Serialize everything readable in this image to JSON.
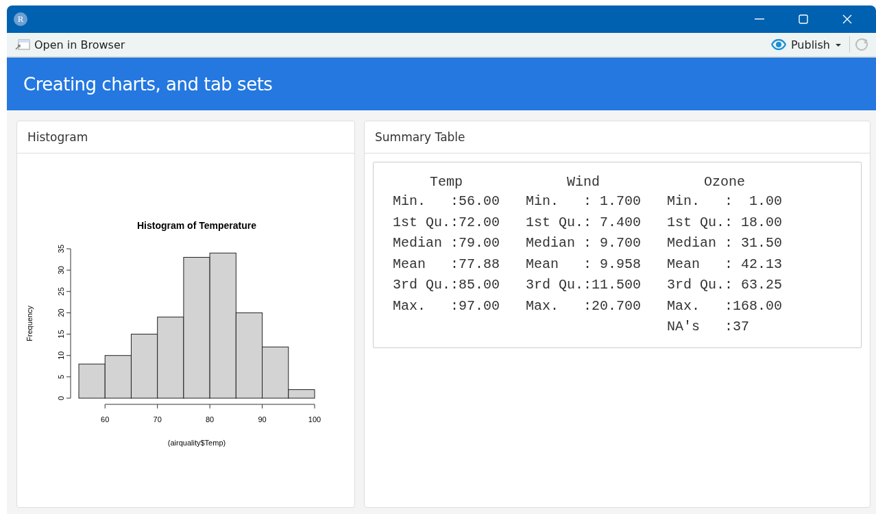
{
  "window": {
    "app_letter": "R"
  },
  "toolbar": {
    "open_in_browser": "Open in Browser",
    "publish": "Publish"
  },
  "header": {
    "title": "Creating charts, and tab sets"
  },
  "histogram_card": {
    "title": "Histogram",
    "chart_data": {
      "type": "bar",
      "title": "Histogram of Temperature",
      "xlabel": "(airquality$Temp)",
      "ylabel": "Frequency",
      "x": [
        57.5,
        62.5,
        67.5,
        72.5,
        77.5,
        82.5,
        87.5,
        92.5,
        97.5
      ],
      "values": [
        8,
        10,
        15,
        19,
        33,
        34,
        20,
        12,
        2
      ],
      "xlim": [
        55,
        100
      ],
      "ylim": [
        0,
        35
      ],
      "xticks": [
        60,
        70,
        80,
        90,
        100
      ],
      "yticks": [
        0,
        5,
        10,
        15,
        20,
        25,
        30,
        35
      ]
    }
  },
  "summary_card": {
    "title": "Summary Table",
    "columns": [
      {
        "header": "Temp",
        "lines": [
          "Min.   :56.00",
          "1st Qu.:72.00",
          "Median :79.00",
          "Mean   :77.88",
          "3rd Qu.:85.00",
          "Max.   :97.00"
        ]
      },
      {
        "header": "Wind",
        "lines": [
          "Min.   : 1.700",
          "1st Qu.: 7.400",
          "Median : 9.700",
          "Mean   : 9.958",
          "3rd Qu.:11.500",
          "Max.   :20.700"
        ]
      },
      {
        "header": "Ozone",
        "lines": [
          "Min.   :  1.00",
          "1st Qu.: 18.00",
          "Median : 31.50",
          "Mean   : 42.13",
          "3rd Qu.: 63.25",
          "Max.   :168.00",
          "NA's   :37"
        ]
      }
    ]
  }
}
